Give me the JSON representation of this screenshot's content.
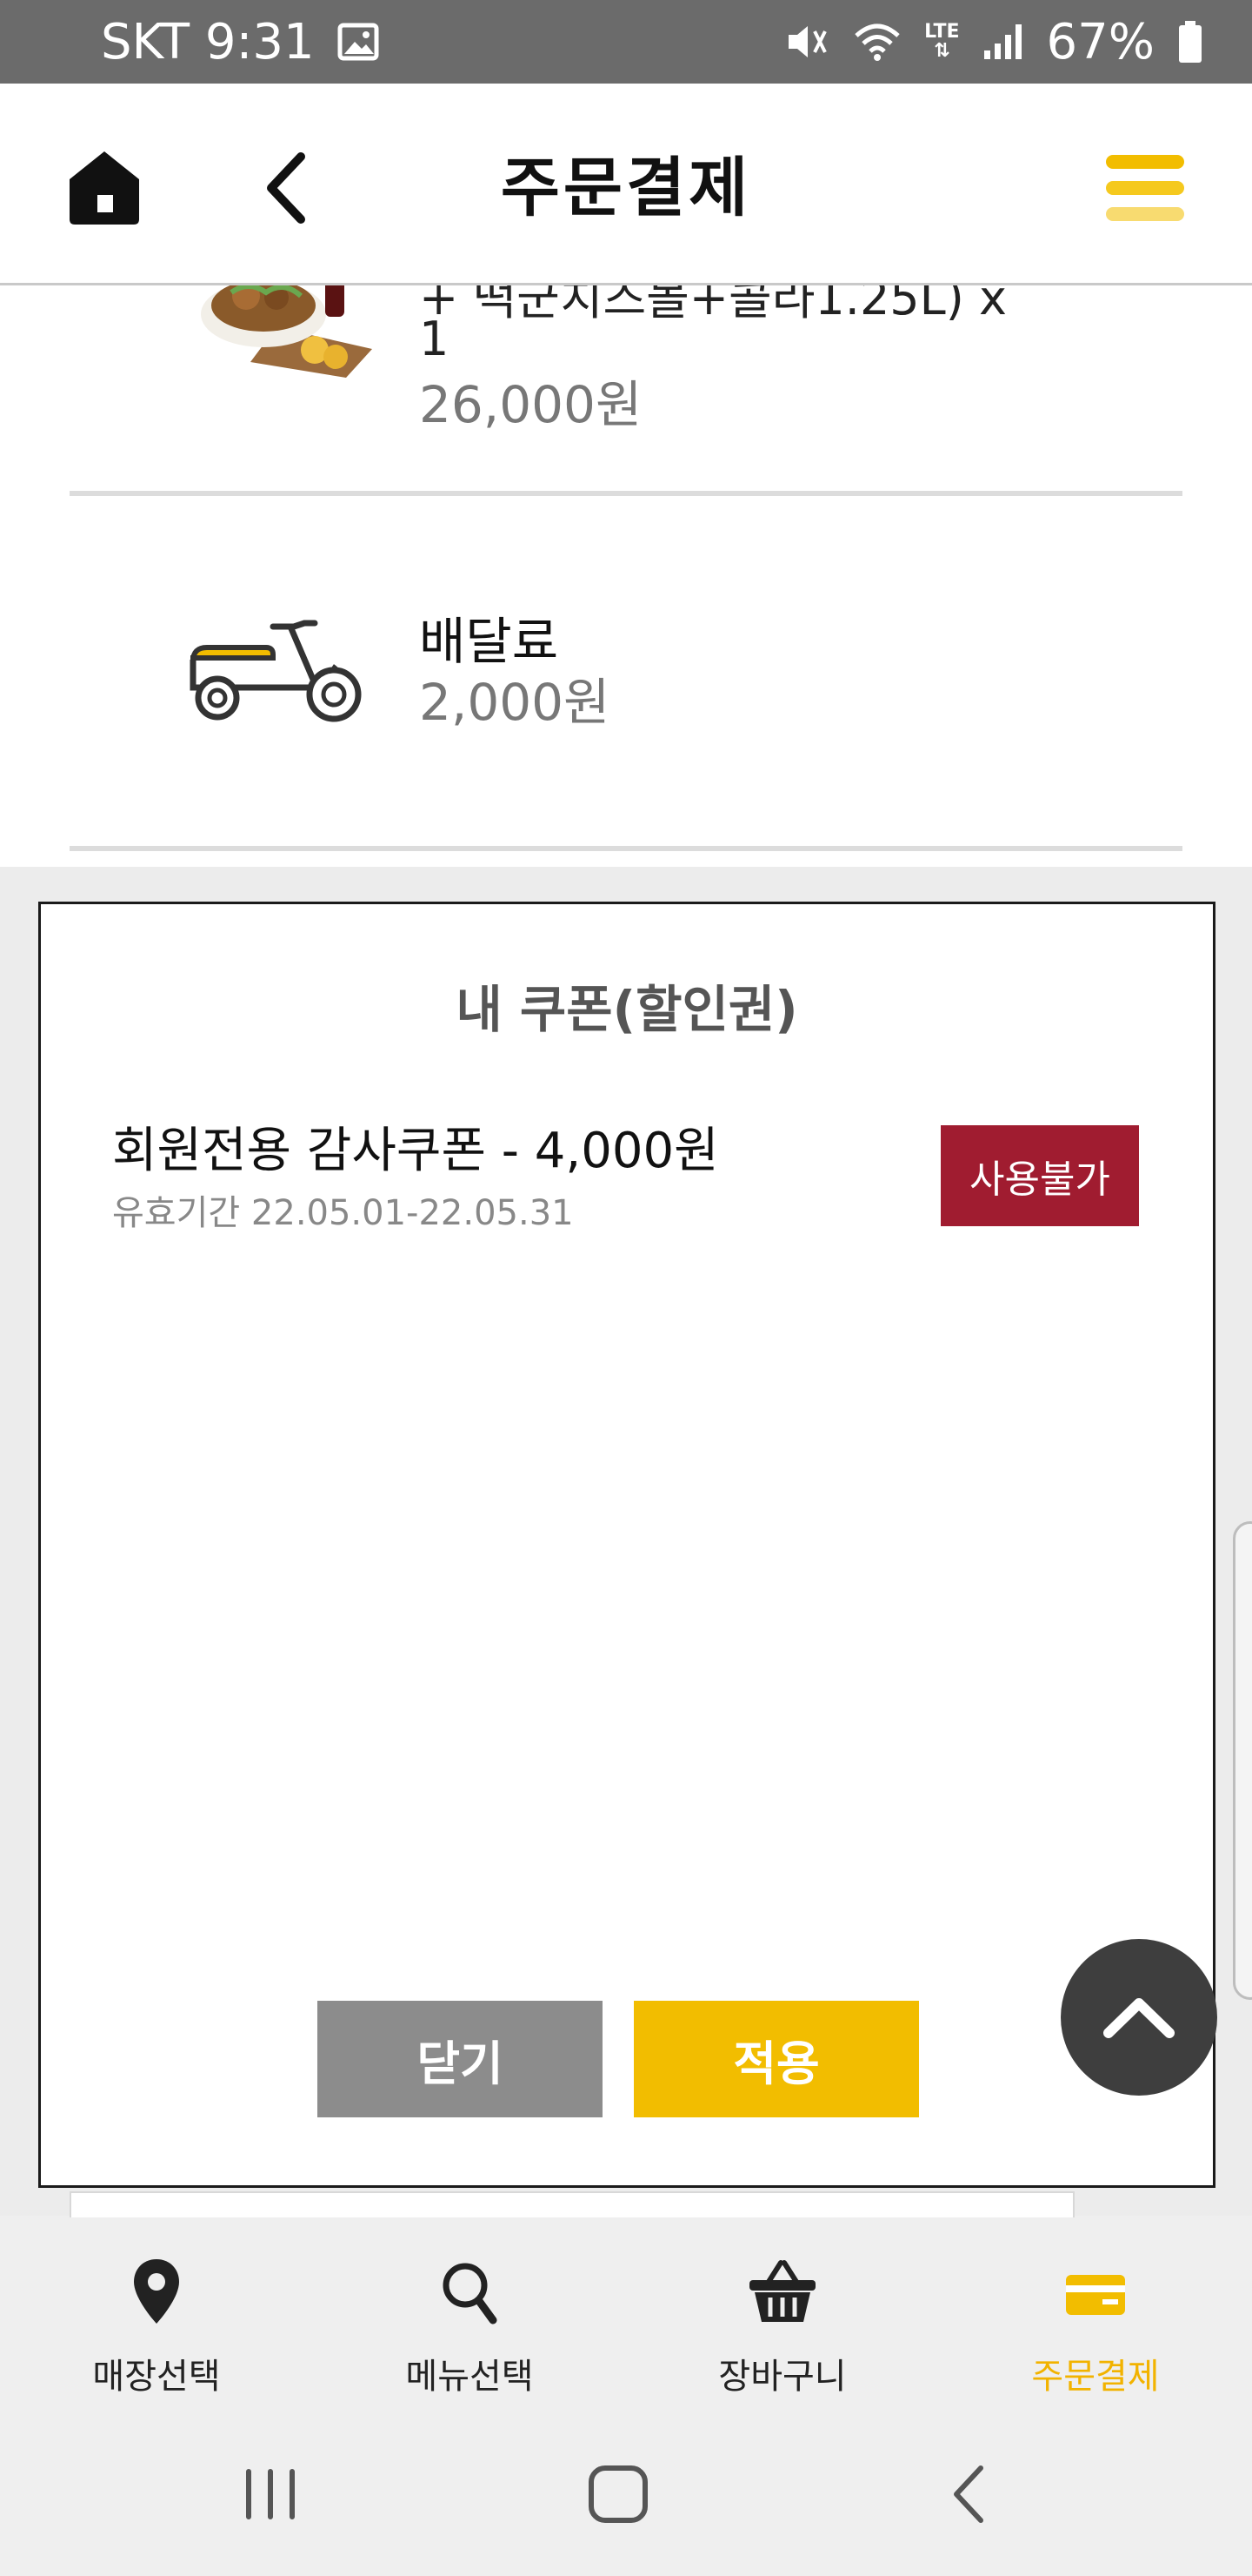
{
  "status_bar": {
    "carrier_time": "SKT 9:31",
    "network": "LTE",
    "battery": "67%",
    "icons": [
      "image-icon",
      "mute-icon",
      "wifi-icon",
      "lte-icon",
      "signal-icon",
      "battery-icon"
    ]
  },
  "header": {
    "title": "주문결제",
    "icons": [
      "home-icon",
      "back-icon",
      "hamburger-menu-icon"
    ]
  },
  "order": {
    "item_name_partial": "+ 떡군치즈볼+콜라1.25L) x",
    "item_qty": "1",
    "item_price": "26,000원",
    "delivery_label": "배달료",
    "delivery_price": "2,000원"
  },
  "coupon_modal": {
    "title": "내 쿠폰(할인권)",
    "coupons": [
      {
        "name": "회원전용 감사쿠폰 - 4,000원",
        "validity": "유효기간 22.05.01-22.05.31",
        "status": "사용불가"
      }
    ],
    "close_label": "닫기",
    "apply_label": "적용"
  },
  "tabs": [
    {
      "label": "매장선택",
      "icon": "location-pin-icon",
      "active": false
    },
    {
      "label": "메뉴선택",
      "icon": "search-icon",
      "active": false
    },
    {
      "label": "장바구니",
      "icon": "basket-icon",
      "active": false
    },
    {
      "label": "주문결제",
      "icon": "card-icon",
      "active": true
    }
  ],
  "colors": {
    "accent_yellow": "#f2bd00",
    "unusable_red": "#a01c30",
    "close_gray": "#8c8c8c",
    "status_bar_gray": "#6b6b6b"
  }
}
